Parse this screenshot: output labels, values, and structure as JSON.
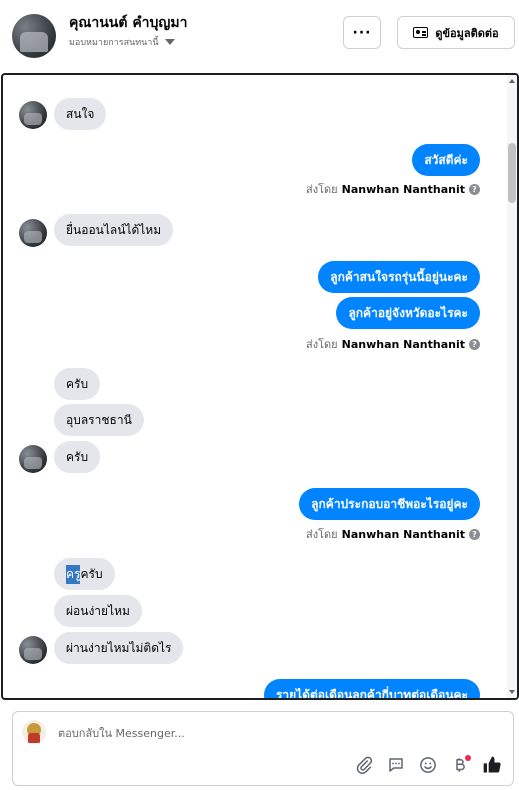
{
  "header": {
    "contact_name": "คุณานนต์ คำบุญมา",
    "assign_label": "มอบหมายการสนทนานี้",
    "more_label": "···",
    "view_contact_label": "ดูข้อมูลติดต่อ"
  },
  "messages": [
    {
      "dir": "in",
      "text": "สนใจ"
    },
    {
      "dir": "out",
      "text": "สวัสดีค่ะ"
    },
    {
      "dir": "in",
      "text": "ยื่นออนไลน์ได้ไหม"
    },
    {
      "dir": "out",
      "text": "ลูกค้าสนใจรถรุ่นนี้อยู่นะคะ"
    },
    {
      "dir": "out",
      "text": "ลูกค้าอยู่จังหวัดอะไรคะ"
    },
    {
      "dir": "in",
      "text": "ครับ"
    },
    {
      "dir": "in",
      "text": "อุบลราชธานี"
    },
    {
      "dir": "in",
      "text": "ครับ"
    },
    {
      "dir": "out",
      "text": "ลูกค้าประกอบอาชีพอะไรอยู่คะ"
    },
    {
      "dir": "in",
      "text_highlight": "ครู",
      "text_rest": "ครับ"
    },
    {
      "dir": "in",
      "text": "ผ่อนง่ายไหม"
    },
    {
      "dir": "in",
      "text": "ผ่านง่ายไหมไม่ติดไร"
    },
    {
      "dir": "out",
      "text": "รายได้ต่อเดือนลูกค้ากี่บาทต่อเดือนคะ"
    }
  ],
  "sent_by": {
    "prefix": "ส่งโดย",
    "name": "Nanwhan Nanthanit",
    "help": "?"
  },
  "composer": {
    "placeholder": "ตอบกลับใน Messenger..."
  },
  "tools": {
    "attach": "paperclip-icon",
    "saved_reply": "chat-bubble-icon",
    "emoji": "smiley-icon",
    "payment": "baht-icon",
    "like": "thumbs-up-icon"
  },
  "colors": {
    "outgoing_bubble": "#0084ff",
    "incoming_bubble": "#e4e6eb",
    "notification_dot": "#f02849"
  }
}
